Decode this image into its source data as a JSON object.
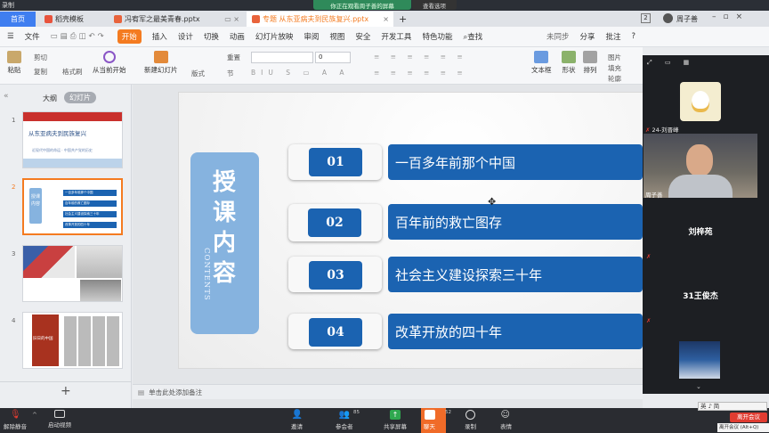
{
  "top": {
    "recording": "录制",
    "screen_share_notice": "你正在观看周子善的屏幕",
    "view_options": "查看选项"
  },
  "tabs": [
    {
      "label": "首页"
    },
    {
      "label": "稻壳模板"
    },
    {
      "label": "冯宥军之最美青春.pptx"
    },
    {
      "label": "专题 从东亚病夫到民族复兴.pptx"
    }
  ],
  "window": {
    "count_badge": "2",
    "user_name": "周子善"
  },
  "menu": [
    "文件",
    "开始",
    "插入",
    "设计",
    "切换",
    "动画",
    "幻灯片放映",
    "审阅",
    "视图",
    "安全",
    "开发工具",
    "特色功能",
    "查找"
  ],
  "menu_right": {
    "sync": "未同步",
    "share": "分享",
    "annotate": "批注",
    "help": "?"
  },
  "ribbon": {
    "paste": "粘贴",
    "cut": "剪切",
    "copy": "复制",
    "format_painter": "格式刷",
    "play_from_current": "从当前开始",
    "new_slide": "新建幻灯片",
    "layout": "版式",
    "reset": "重置",
    "section": "节",
    "font_size": "0",
    "textbox": "文本框",
    "shape": "形状",
    "arrange": "排列",
    "picture": "图片",
    "fill": "填充",
    "outline": "轮廓"
  },
  "left_panel": {
    "tab_outline": "大纲",
    "tab_slides": "幻灯片",
    "add_slide": "+"
  },
  "thumbs": [
    {
      "num": "1",
      "title": "从东亚病夫到民族复兴",
      "subtitle": "近现代中国的命运 · 中国共产党的历史"
    },
    {
      "num": "2",
      "title": "授课内容",
      "items": [
        "一百多年前那个中国",
        "百年前的救亡图存",
        "社会主义建设探索三十年",
        "改革开放的四十年"
      ]
    },
    {
      "num": "3"
    },
    {
      "num": "4",
      "title": "旧日的中国"
    }
  ],
  "slide": {
    "vertical_title": "授课内容",
    "contents_word": "CONTENTS",
    "rows": [
      {
        "num": "01",
        "text": "一百多年前那个中国"
      },
      {
        "num": "02",
        "text": "百年前的救亡图存"
      },
      {
        "num": "03",
        "text": "社会主义建设探索三十年"
      },
      {
        "num": "04",
        "text": "改革开放的四十年"
      }
    ]
  },
  "notes_placeholder": "单击此处添加备注",
  "participants": [
    {
      "name": "24-刘晋峰"
    },
    {
      "name": "周子善"
    },
    {
      "name": "刘梓苑"
    },
    {
      "name": "31王俊杰"
    }
  ],
  "bottom": {
    "unmute": "解除静音",
    "start_video": "启动视频",
    "invite": "邀请",
    "members": "参会者",
    "members_count": "85",
    "share_screen": "共享屏幕",
    "chat": "聊天",
    "chat_count": "52",
    "record": "录制",
    "reactions": "表情",
    "leave": "离开会议",
    "leave_hint": "离开会议 (Alt+Q)",
    "ime": "英 ♪ 简"
  },
  "colors": {
    "accent_orange": "#f47b20",
    "slide_blue": "#1b63b1",
    "card_blue": "#86b3df",
    "chat_orange": "#f06b28",
    "leave_red": "#e03c31"
  }
}
